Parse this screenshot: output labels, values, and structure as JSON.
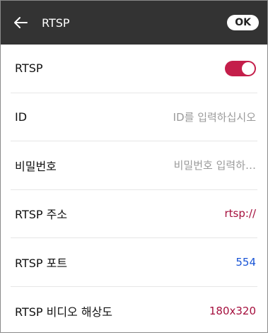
{
  "header": {
    "title": "RTSP",
    "ok_label": "OK"
  },
  "rows": [
    {
      "label": "RTSP",
      "toggle_on": true,
      "toggle_color": "#c41e4a"
    },
    {
      "label": "ID",
      "placeholder": "ID를 입력하십시오"
    },
    {
      "label": "비밀번호",
      "placeholder": "비밀번호 입력하…"
    },
    {
      "label": "RTSP 주소",
      "value": "rtsp://"
    },
    {
      "label": "RTSP 포트",
      "value": "554"
    },
    {
      "label": "RTSP 비디오 해상도",
      "value": "180x320"
    }
  ],
  "colors": {
    "topbar": "#333333",
    "accent": "#a50f3d",
    "link_blue": "#1a55d6"
  },
  "icons": {
    "back": "arrow-left-icon"
  }
}
